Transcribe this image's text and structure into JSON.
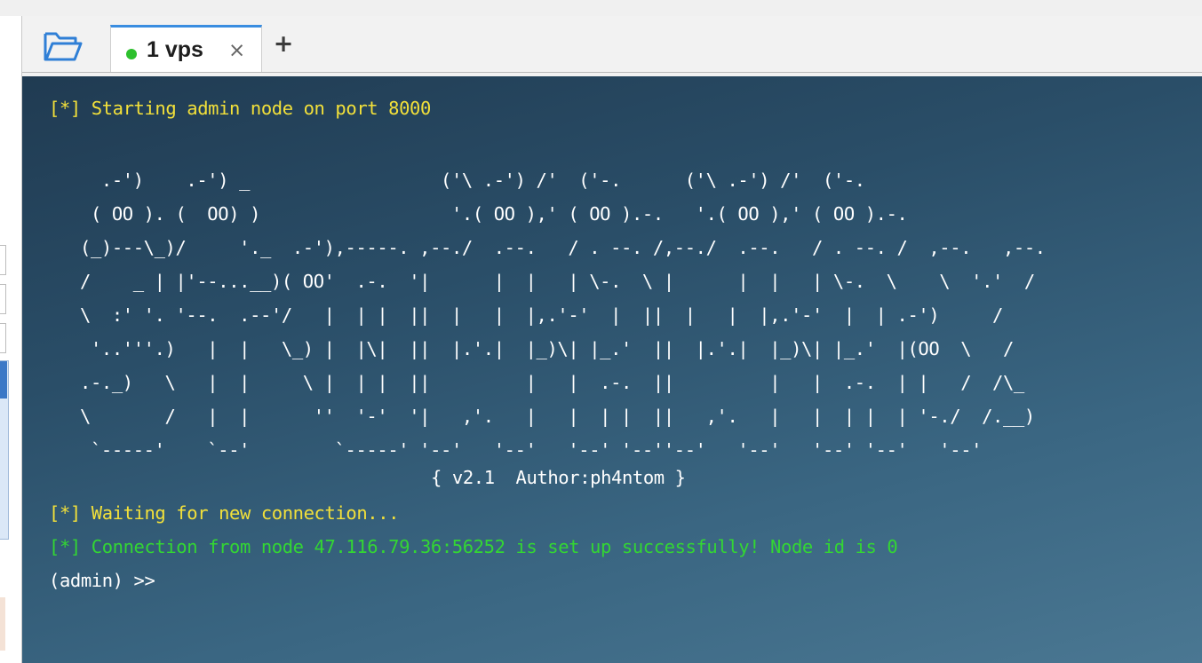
{
  "tabbar": {
    "folder_icon": "folder-open-icon",
    "tab": {
      "status_color": "#2dc02d",
      "label": "1 vps",
      "close_glyph": "×"
    },
    "new_tab_glyph": "+"
  },
  "terminal": {
    "background": "#2a4e68",
    "line1": "[*] Starting admin node on port 8000",
    "banner": "  .-')    .-') _                  ('\\ .-') /'  ('-.      ('\\ .-') /'  ('-.\n ( OO ). (  OO) )                  '.( OO ),' ( OO ).-.   '.( OO ),' ( OO ).-.\n(_)---\\_)/     '._  .-'),-----. ,--./  .--.   / . --. /,--./  .--.   / . --. /  ,--.   ,--.\n/    _ | |'--...__)( OO'  .-.  '|      |  |   | \\-.  \\ |      |  |   | \\-.  \\    \\  '.'  /\n\\  :' '. '--.  .--'/   |  | |  ||  |   |  |,.'-'  |  ||  |   |  |,.'-'  |  | .-')     /\n '..'''.)   |  |   \\_) |  |\\|  ||  |.'.|  |_)\\| |_.'  ||  |.'.|  |_)\\| |_.'  |(OO  \\   /\n.-._)   \\   |  |     \\ |  | |  ||         |   |  .-.  ||         |   |  .-.  | |   /  /\\_\n\\       /   |  |      ''  '-'  '|   ,'.   |   |  | |  ||   ,'.   |   |  | |  | '-./  /.__)\n `-----'    `--'        `-----' '--'   '--'   '--' '--''--'   '--'   '--' '--'   '--'",
    "version": "{ v2.1  Author:ph4ntom }",
    "line_waiting": "[*] Waiting for new connection...",
    "line_connection": "[*] Connection from node 47.116.79.36:56252 is set up successfully! Node id is 0",
    "prompt": "(admin) >>",
    "colors": {
      "info": "#f2e03a",
      "success": "#33d633",
      "text": "#ffffff"
    }
  }
}
